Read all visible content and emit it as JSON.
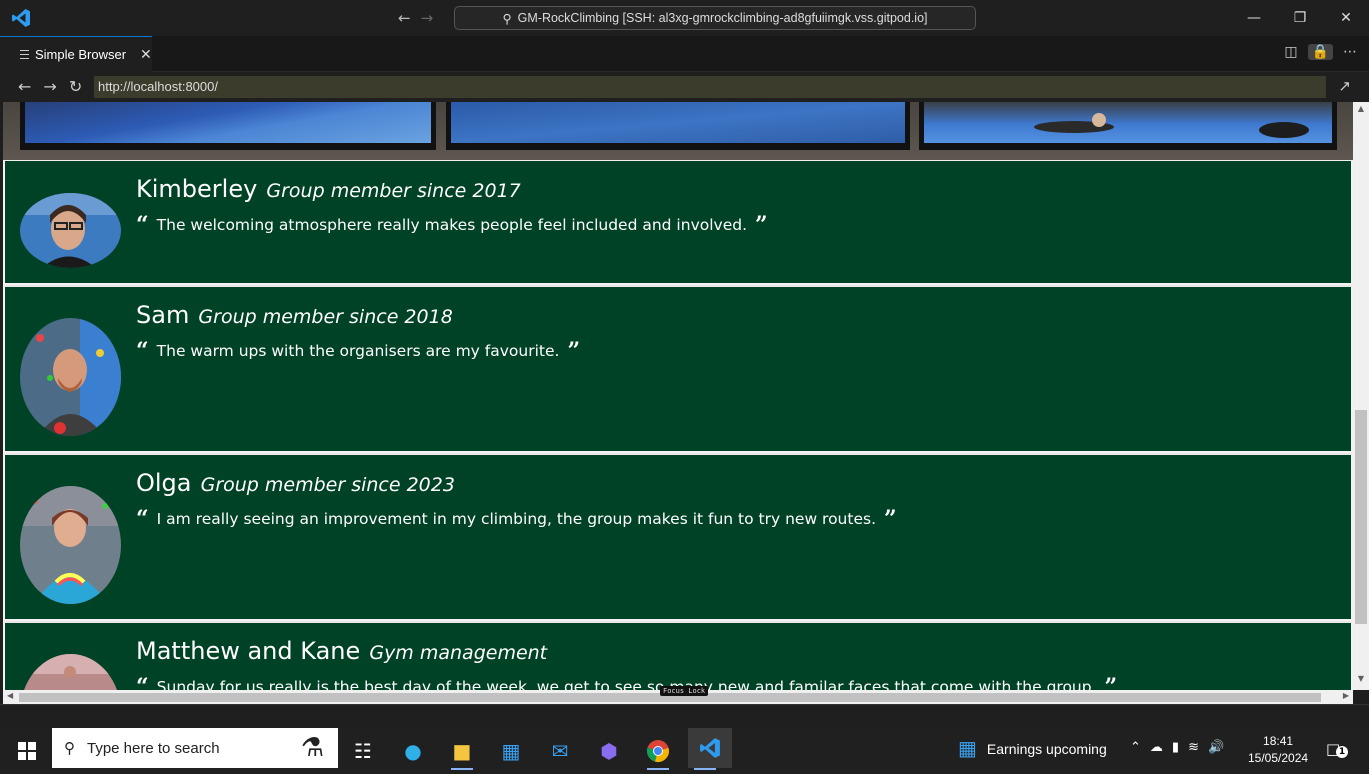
{
  "window": {
    "command_center_text": "GM-RockClimbing [SSH: al3xg-gmrockclimbing-ad8gfuiimgk.vss.gitpod.io]"
  },
  "tab": {
    "label": "Simple Browser"
  },
  "browser": {
    "url": "http://localhost:8000/"
  },
  "testimonials": [
    {
      "name": "Kimberley",
      "since": "Group member since 2017",
      "quote": "The welcoming atmosphere really makes people feel included and involved."
    },
    {
      "name": "Sam",
      "since": "Group member since 2018",
      "quote": "The warm ups with the organisers are my favourite."
    },
    {
      "name": "Olga",
      "since": "Group member since 2023",
      "quote": "I am really seeing an improvement in my climbing, the group makes it fun to try new routes."
    },
    {
      "name": "Matthew and Kane",
      "since": "Gym management",
      "quote": "Sunday for us really is the best day of the week, we get to see so many new and familar faces that come with the group."
    }
  ],
  "overlay": {
    "focus_lock": "Focus Lock"
  },
  "taskbar": {
    "search_placeholder": "Type here to search",
    "weather_text": "Earnings upcoming",
    "time": "18:41",
    "date": "15/05/2024",
    "notification_count": "1"
  },
  "colors": {
    "card_background": "#004225",
    "accent": "#0078d4"
  }
}
